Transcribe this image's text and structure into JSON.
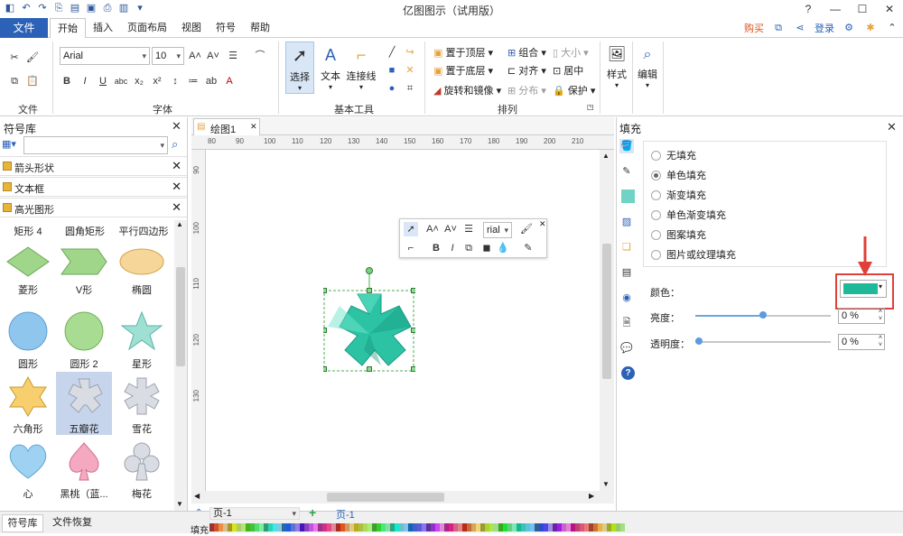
{
  "window": {
    "title": "亿图图示（试用版）"
  },
  "ribbon_tabs": {
    "file": "文件",
    "tabs": [
      "开始",
      "插入",
      "页面布局",
      "视图",
      "符号",
      "帮助"
    ]
  },
  "top_right": {
    "buy": "购买",
    "login": "登录"
  },
  "font": {
    "name": "Arial",
    "size": "10"
  },
  "ribbon_groups": {
    "file": "文件",
    "font": "字体",
    "basic_tools": "基本工具",
    "arrange": "排列"
  },
  "basic_tools": {
    "select": "选择",
    "text": "文本",
    "connector": "连接线"
  },
  "arrange": {
    "front": "置于顶层",
    "back": "置于底层",
    "rotate": "旋转和镜像",
    "group": "组合",
    "align": "对齐",
    "distribute": "分布",
    "size": "大小",
    "center": "居中",
    "protect": "保护"
  },
  "style_btn": "样式",
  "edit_btn": "编辑",
  "library": {
    "title": "符号库",
    "headers": [
      "箭头形状",
      "文本框",
      "高光图形"
    ],
    "top_labels": [
      "矩形 4",
      "圆角矩形",
      "平行四边形"
    ],
    "shapes": [
      "菱形",
      "V形",
      "椭圆",
      "圆形",
      "圆形 2",
      "星形",
      "六角形",
      "五瓣花",
      "雪花",
      "心",
      "黑桃（蓝...",
      "梅花"
    ]
  },
  "doc_tab": "绘图1",
  "ruler_top": [
    "80",
    "90",
    "100",
    "110",
    "120",
    "130",
    "140",
    "150",
    "160",
    "170",
    "180",
    "190",
    "200",
    "210"
  ],
  "ruler_left": [
    "90",
    "100",
    "110",
    "120",
    "130"
  ],
  "floating_toolbar": {
    "font": "rial"
  },
  "fill_panel": {
    "title": "填充",
    "options": [
      "无填充",
      "单色填充",
      "渐变填充",
      "单色渐变填充",
      "图案填充",
      "图片或纹理填充"
    ],
    "selected_index": 1,
    "color_label": "颜色：",
    "color_value": "#1fb99a",
    "brightness_label": "亮度：",
    "brightness_value": "0 %",
    "brightness_level": 0.5,
    "transparency_label": "透明度：",
    "transparency_value": "0 %",
    "transparency_level": 0
  },
  "bottom": {
    "page_combo": "页-1",
    "page_tab": "页-1",
    "fill_label": "填充",
    "library_tab": "符号库",
    "recover_tab": "文件恢复"
  },
  "colors": {
    "accent": "#2b62b8",
    "shape_teal": "#2cc3a5",
    "highlight_red": "#e0403a"
  }
}
